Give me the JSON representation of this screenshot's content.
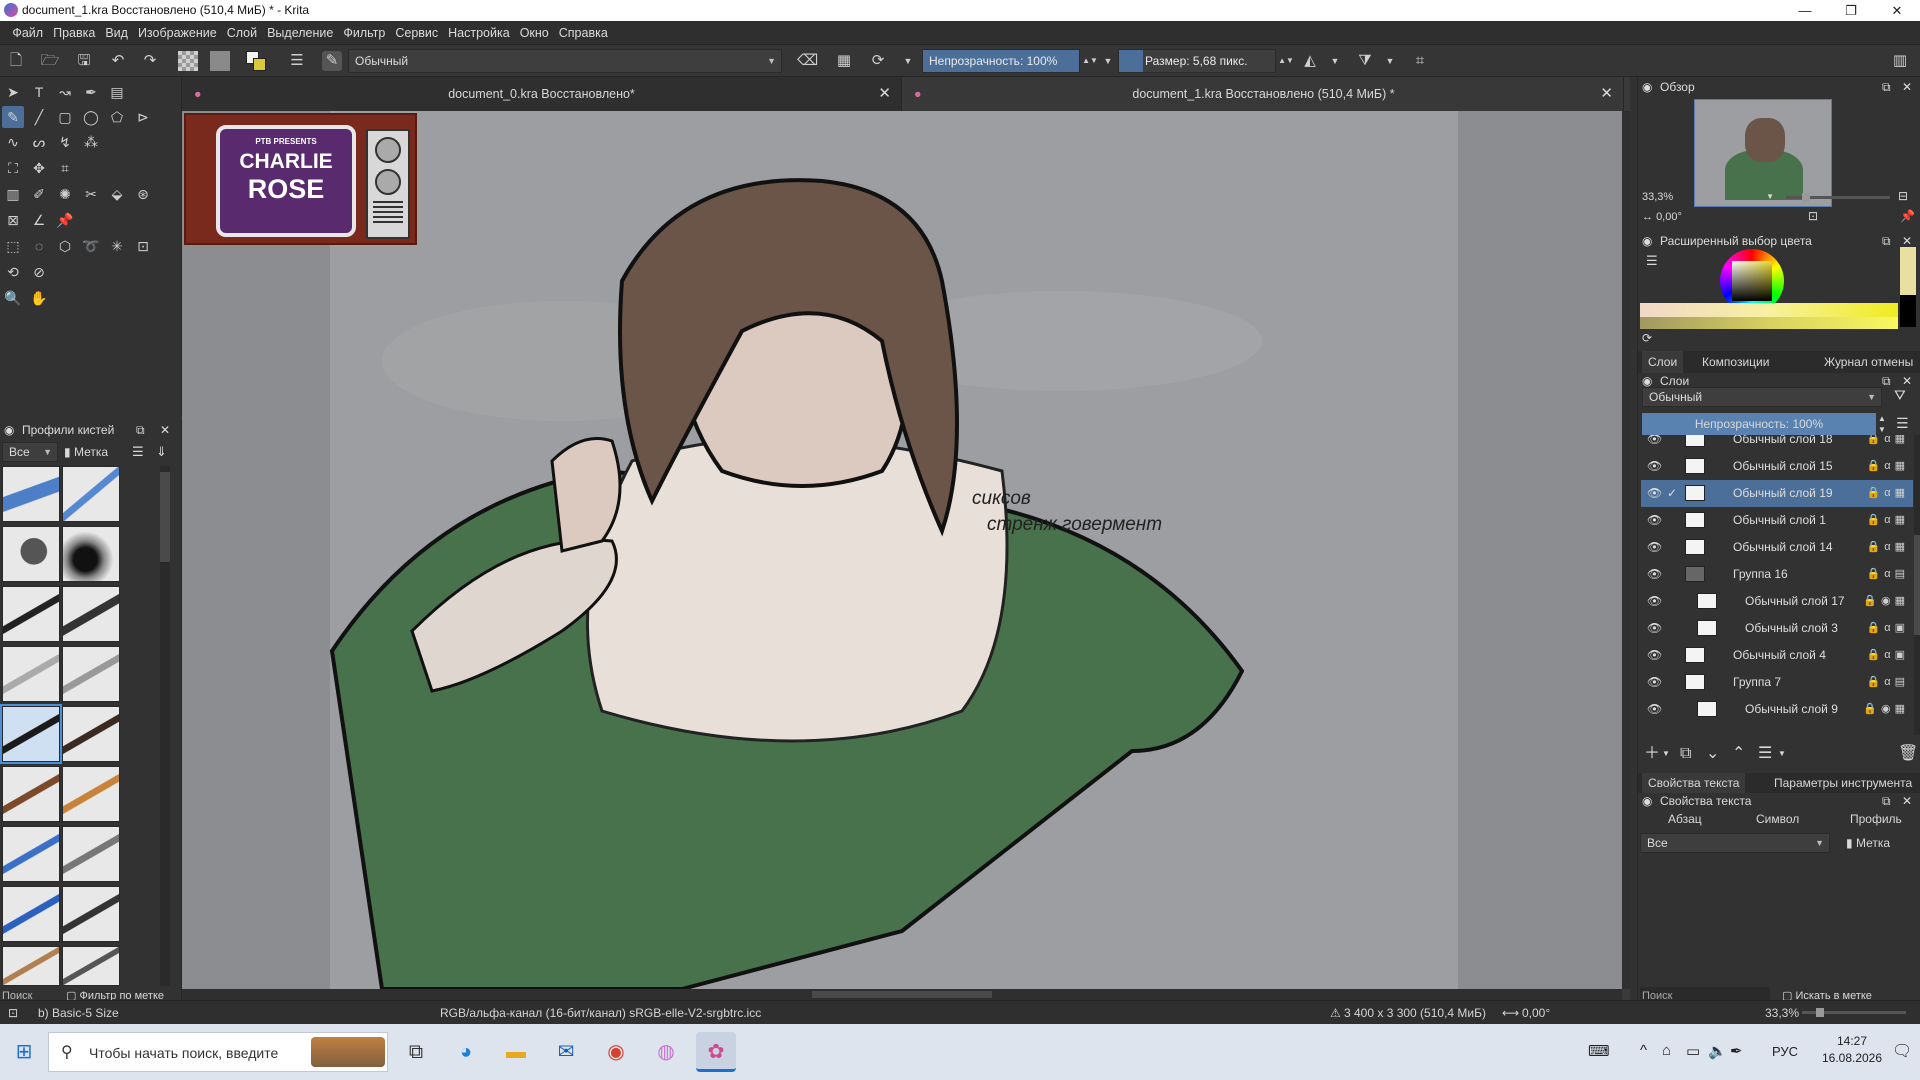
{
  "window": {
    "title": "document_1.kra Восстановлено (510,4 МиБ) * - Krita",
    "controls": [
      "—",
      "❐",
      "✕"
    ]
  },
  "menu": [
    "Файл",
    "Правка",
    "Вид",
    "Изображение",
    "Слой",
    "Выделение",
    "Фильтр",
    "Сервис",
    "Настройка",
    "Окно",
    "Справка"
  ],
  "toolbar": {
    "blend_mode": "Обычный",
    "opacity": "Непрозрачность: 100%",
    "size": "Размер: 5,68 пикс."
  },
  "tabs": [
    {
      "label": "document_0.kra Восстановлено*"
    },
    {
      "label": "document_1.kra Восстановлено (510,4 МиБ) *"
    }
  ],
  "canvas": {
    "annotation_line1": "сиксов",
    "annotation_line2": "стренж говермент",
    "tv_small": "PTB PRESENTS",
    "tv_line1": "CHARLIE",
    "tv_line2": "ROSE"
  },
  "brush_presets": {
    "title": "Профили кистей",
    "filter_all": "Все",
    "tag": "Метка",
    "search_placeholder": "Поиск",
    "filter_by_tag": "Фильтр по метке"
  },
  "overview": {
    "title": "Обзор",
    "zoom": "33,3%",
    "rotation": "0,00°"
  },
  "color_selector": {
    "title": "Расширенный выбор цвета"
  },
  "layer_tabs": [
    "Слои",
    "Композиции",
    "Журнал отмены"
  ],
  "layers_panel": {
    "title": "Слои",
    "blend_mode": "Обычный",
    "opacity": "Непрозрачность: 100%",
    "items": [
      {
        "name": "Обычный слой 18",
        "selected": false,
        "indent": 0
      },
      {
        "name": "Обычный слой 15",
        "selected": false,
        "indent": 0
      },
      {
        "name": "Обычный слой 19",
        "selected": true,
        "indent": 0
      },
      {
        "name": "Обычный слой 1",
        "selected": false,
        "indent": 0
      },
      {
        "name": "Обычный слой 14",
        "selected": false,
        "indent": 0
      },
      {
        "name": "Группа 16",
        "selected": false,
        "indent": 0
      },
      {
        "name": "Обычный слой 17",
        "selected": false,
        "indent": 1
      },
      {
        "name": "Обычный слой 3",
        "selected": false,
        "indent": 1
      },
      {
        "name": "Обычный слой 4",
        "selected": false,
        "indent": 0
      },
      {
        "name": "Группа 7",
        "selected": false,
        "indent": 0
      },
      {
        "name": "Обычный слой 9",
        "selected": false,
        "indent": 1
      }
    ]
  },
  "text_tabs": [
    "Свойства текста",
    "Параметры инструмента"
  ],
  "text_props": {
    "title": "Свойства текста",
    "tabs": [
      "Абзац",
      "Символ",
      "Профиль"
    ],
    "filter": "Все",
    "tag": "Метка",
    "search_placeholder": "Поиск",
    "search_in_tag": "Искать в метке"
  },
  "status": {
    "brush": "b) Basic-5 Size",
    "color_space": "RGB/альфа-канал (16-бит/канал)  sRGB-elle-V2-srgbtrc.icc",
    "dimensions": "3 400 x 3 300 (510,4 МиБ)",
    "rotation": "0,00°",
    "zoom": "33,3%"
  },
  "taskbar": {
    "search_placeholder": "Чтобы начать поиск, введите",
    "lang": "РУС",
    "time": "14:27",
    "date": "16.08.2026"
  }
}
